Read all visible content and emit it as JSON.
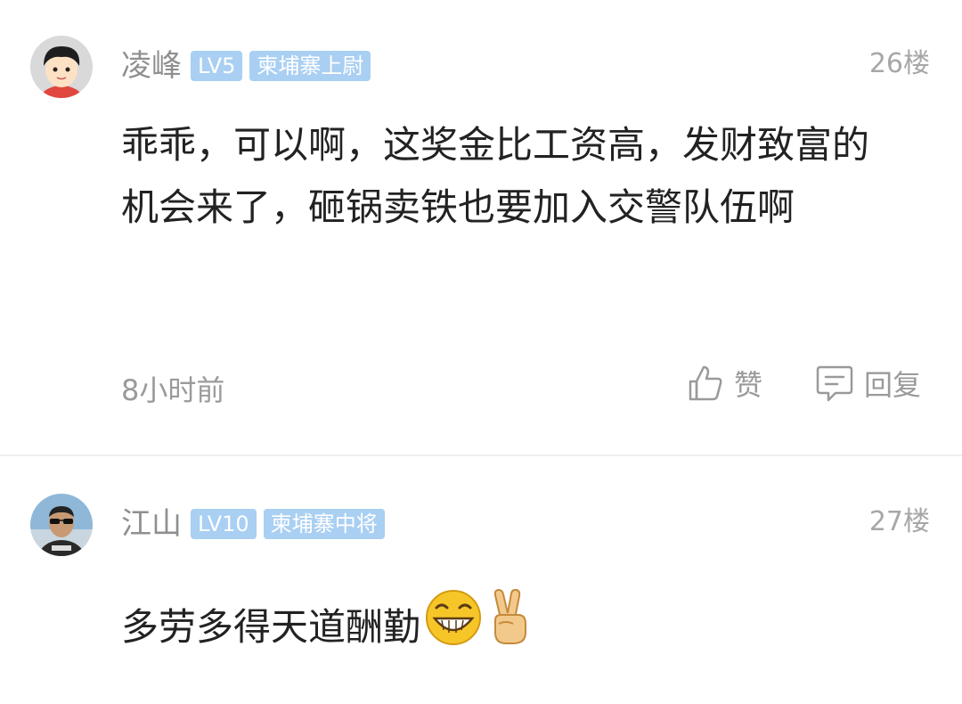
{
  "comments": [
    {
      "username": "凌峰",
      "level": "LV5",
      "title": "柬埔寨上尉",
      "floor": "26楼",
      "text": "乖乖，可以啊，这奖金比工资高，发财致富的机会来了，砸锅卖铁也要加入交警队伍啊",
      "time": "8小时前",
      "like_label": "赞",
      "reply_label": "回复"
    },
    {
      "username": "江山",
      "level": "LV10",
      "title": "柬埔寨中将",
      "floor": "27楼",
      "text": "多劳多得天道酬勤",
      "emojis": [
        "grinning-face-emoji",
        "victory-hand-emoji"
      ]
    }
  ],
  "icons": [
    "thumbs-up-icon",
    "comment-bubble-icon"
  ],
  "colors": {
    "badge_bg": "#a9cff2",
    "meta_text": "#9a9a9a",
    "body_text": "#222222"
  }
}
